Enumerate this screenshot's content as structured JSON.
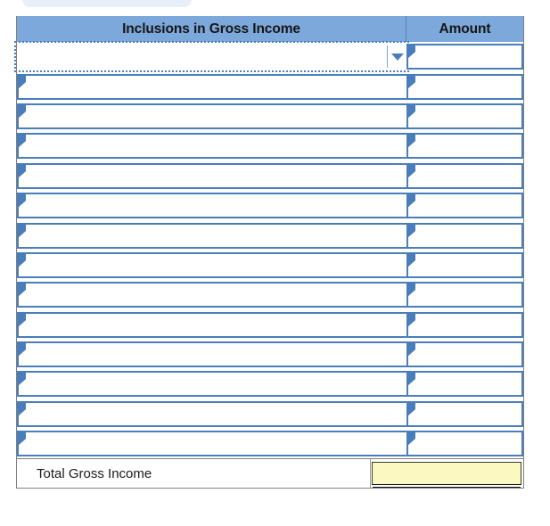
{
  "decor": {
    "top_pill_color": "#e9eff8"
  },
  "theme": {
    "header_fill": "#7ca8db",
    "control_border": "#4a7ebb",
    "total_fill": "#fbf8c2",
    "table_border": "#7f7f7f"
  },
  "worksheet": {
    "columns": [
      {
        "key": "description",
        "label": "Inclusions in Gross Income",
        "align": "center"
      },
      {
        "key": "amount",
        "label": "Amount",
        "align": "center"
      }
    ],
    "rows": [
      {
        "index": 1,
        "description": "",
        "description_placeholder": "",
        "amount": "",
        "focused": true,
        "has_dropdown_arrow": true
      },
      {
        "index": 2,
        "description": "",
        "description_placeholder": "",
        "amount": "",
        "focused": false,
        "has_dropdown_arrow": false
      },
      {
        "index": 3,
        "description": "",
        "description_placeholder": "",
        "amount": "",
        "focused": false,
        "has_dropdown_arrow": false
      },
      {
        "index": 4,
        "description": "",
        "description_placeholder": "",
        "amount": "",
        "focused": false,
        "has_dropdown_arrow": false
      },
      {
        "index": 5,
        "description": "",
        "description_placeholder": "",
        "amount": "",
        "focused": false,
        "has_dropdown_arrow": false
      },
      {
        "index": 6,
        "description": "",
        "description_placeholder": "",
        "amount": "",
        "focused": false,
        "has_dropdown_arrow": false
      },
      {
        "index": 7,
        "description": "",
        "description_placeholder": "",
        "amount": "",
        "focused": false,
        "has_dropdown_arrow": false
      },
      {
        "index": 8,
        "description": "",
        "description_placeholder": "",
        "amount": "",
        "focused": false,
        "has_dropdown_arrow": false
      },
      {
        "index": 9,
        "description": "",
        "description_placeholder": "",
        "amount": "",
        "focused": false,
        "has_dropdown_arrow": false
      },
      {
        "index": 10,
        "description": "",
        "description_placeholder": "",
        "amount": "",
        "focused": false,
        "has_dropdown_arrow": false
      },
      {
        "index": 11,
        "description": "",
        "description_placeholder": "",
        "amount": "",
        "focused": false,
        "has_dropdown_arrow": false
      },
      {
        "index": 12,
        "description": "",
        "description_placeholder": "",
        "amount": "",
        "focused": false,
        "has_dropdown_arrow": false
      },
      {
        "index": 13,
        "description": "",
        "description_placeholder": "",
        "amount": "",
        "focused": false,
        "has_dropdown_arrow": false
      },
      {
        "index": 14,
        "description": "",
        "description_placeholder": "",
        "amount": "",
        "focused": false,
        "has_dropdown_arrow": false
      }
    ],
    "total": {
      "label": "Total Gross Income",
      "value": "",
      "placeholder": ""
    }
  },
  "icons": {
    "row_marker": "triangle-right-icon",
    "dropdown": "chevron-down-icon"
  }
}
